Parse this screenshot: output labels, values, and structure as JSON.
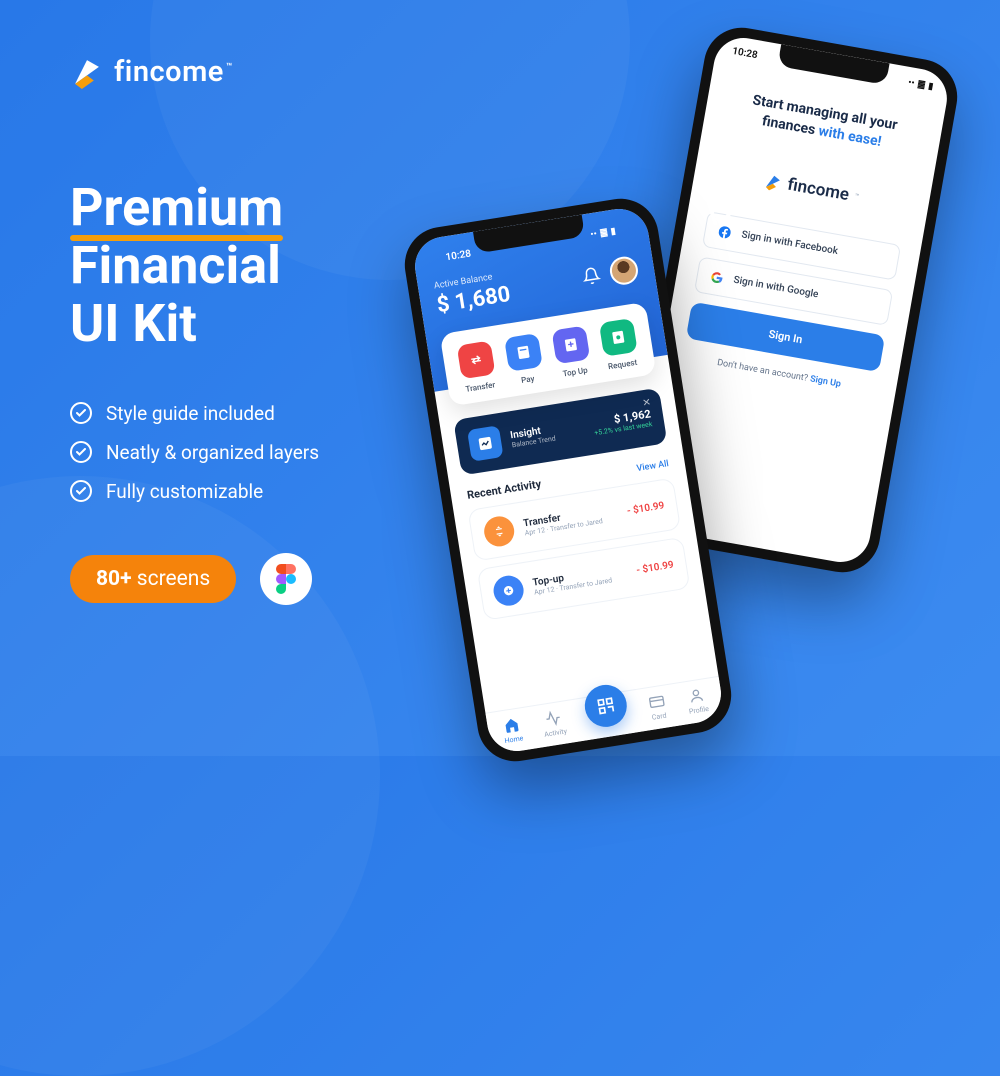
{
  "brand": {
    "name": "fincome",
    "tm": "™"
  },
  "headline": {
    "line1": "Premium",
    "line2": "Financial",
    "line3": "UI Kit"
  },
  "features": [
    "Style guide included",
    "Neatly & organized layers",
    "Fully customizable"
  ],
  "badges": {
    "screens_count": "80+",
    "screens_label": "screens"
  },
  "phone_signin": {
    "status_time": "10:28",
    "hero_pre": "Start managing all your",
    "hero_post": "finances",
    "hero_accent": "with ease!",
    "facebook": "Sign in with Facebook",
    "google": "Sign in with Google",
    "signin": "Sign In",
    "no_account": "Don't have an account?",
    "signup": "Sign Up"
  },
  "phone_home": {
    "status_time": "10:28",
    "balance_label": "Active Balance",
    "balance_value": "$ 1,680",
    "actions": [
      {
        "label": "Transfer"
      },
      {
        "label": "Pay"
      },
      {
        "label": "Top Up"
      },
      {
        "label": "Request"
      }
    ],
    "insight": {
      "title": "Insight",
      "subtitle": "Balance Trend",
      "value": "$ 1,962",
      "delta": "+5.2% vs last week"
    },
    "recent": {
      "title": "Recent Activity",
      "view_all": "View All",
      "items": [
        {
          "title": "Transfer",
          "date": "Apr 12",
          "desc": "Transfer to Jared",
          "amount": "- $10.99"
        },
        {
          "title": "Top-up",
          "date": "Apr 12",
          "desc": "Transfer to Jared",
          "amount": "- $10.99"
        }
      ]
    },
    "tabs": [
      {
        "label": "Home"
      },
      {
        "label": "Activity"
      },
      {
        "label": "Card"
      },
      {
        "label": "Profile"
      }
    ]
  }
}
